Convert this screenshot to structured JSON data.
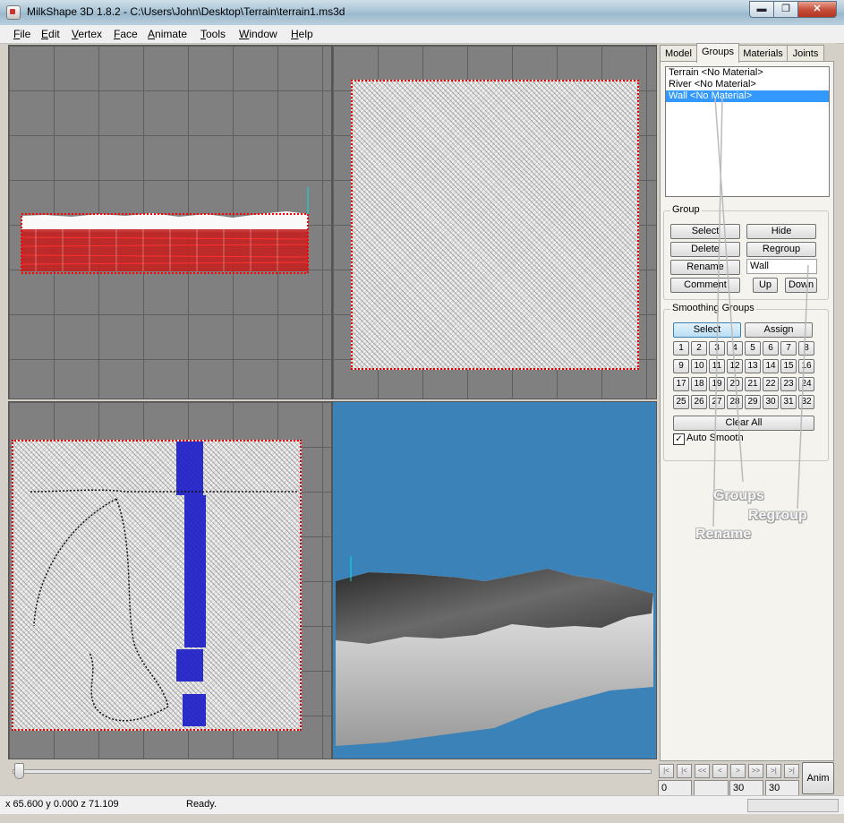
{
  "window": {
    "title": "MilkShape 3D 1.8.2 - C:\\Users\\John\\Desktop\\Terrain\\terrain1.ms3d",
    "min_label": "▬",
    "max_label": "❐",
    "close_label": "✕"
  },
  "menu": [
    "File",
    "Edit",
    "Vertex",
    "Face",
    "Animate",
    "Tools",
    "Window",
    "Help"
  ],
  "tabs": [
    "Model",
    "Groups",
    "Materials",
    "Joints"
  ],
  "groups_list": [
    "Terrain <No Material>",
    "River <No Material>",
    "Wall <No Material>"
  ],
  "group_section": {
    "title": "Group",
    "select": "Select",
    "hide": "Hide",
    "delete": "Delete",
    "regroup": "Regroup",
    "rename": "Rename",
    "name_value": "Wall",
    "comment": "Comment",
    "up": "Up",
    "down": "Down"
  },
  "smoothing": {
    "title": "Smoothing Groups",
    "select": "Select",
    "assign": "Assign",
    "numbers": [
      "1",
      "2",
      "3",
      "4",
      "5",
      "6",
      "7",
      "8",
      "9",
      "10",
      "11",
      "12",
      "13",
      "14",
      "15",
      "16",
      "17",
      "18",
      "19",
      "20",
      "21",
      "22",
      "23",
      "24",
      "25",
      "26",
      "27",
      "28",
      "29",
      "30",
      "31",
      "32"
    ],
    "clear_all": "Clear All",
    "auto_smooth": "Auto Smooth",
    "auto_smooth_checked": true
  },
  "annotations": {
    "groups": "Groups",
    "regroup": "Regroup",
    "rename": "Rename"
  },
  "anim": {
    "button": "Anim",
    "nav": [
      "|<",
      "|<",
      "<<",
      "<",
      ">",
      ">>",
      ">|",
      ">|"
    ],
    "frame": "0",
    "start": "",
    "end": "30",
    "total": "30"
  },
  "status": {
    "coords": "x 65.600 y 0.000 z 71.109",
    "message": "Ready."
  },
  "colors": {
    "selection": "#e00000",
    "river": "#1a1ac8",
    "sky": "#3a82b8",
    "list_selection": "#3399ff"
  }
}
